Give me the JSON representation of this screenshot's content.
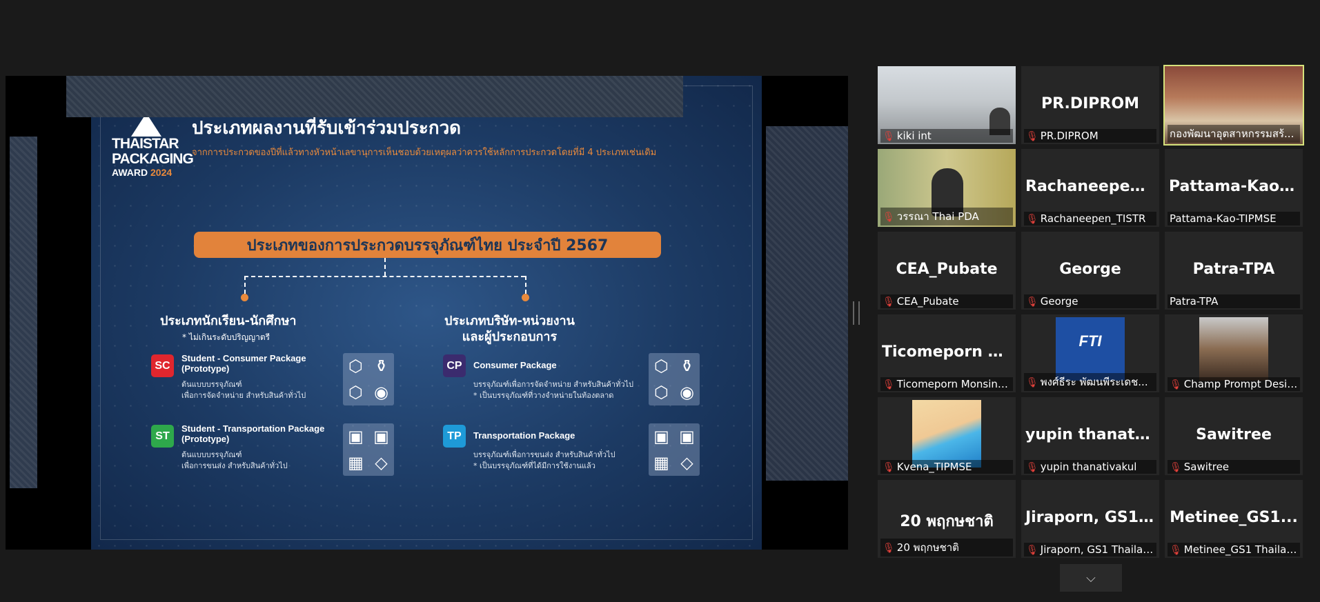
{
  "slide": {
    "logo_line1": "THAISTAR",
    "logo_line2": "PACKAGING",
    "logo_line3_a": "AWARD",
    "logo_line3_b": "2024",
    "title": "ประเภทผลงานที่รับเข้าร่วมประกวด",
    "subtitle": "จากการประกวดของปีที่แล้วทางหัวหน้าเลขานุการเห็นชอบด้วยเหตุผลว่าควรใช้หลักการประกวดโดยที่มี 4 ประเภทเช่นเดิม",
    "banner": "ประเภทของการประกวดบรรจุภัณฑ์ไทย ประจำปี 2567",
    "left_heading": "ประเภทนักเรียน-นักศึกษา",
    "left_note": "* ไม่เกินระดับปริญญาตรี",
    "right_heading_1": "ประเภทบริษัท-หน่วยงาน",
    "right_heading_2": "และผู้ประกอบการ",
    "categories": [
      {
        "code": "SC",
        "color": "#e0262e",
        "name": "Student - Consumer Package (Prototype)",
        "desc1": "ต้นแบบบรรจุภัณฑ์",
        "desc2": "เพื่อการจัดจำหน่าย สำหรับสินค้าทั่วไป",
        "icons": [
          "⬡",
          "⚱",
          "⬡",
          "◉"
        ]
      },
      {
        "code": "CP",
        "color": "#3b2b6e",
        "name": "Consumer Package",
        "desc1": "บรรจุภัณฑ์เพื่อการจัดจำหน่าย สำหรับสินค้าทั่วไป",
        "desc2": "* เป็นบรรจุภัณฑ์ที่วางจำหน่ายในท้องตลาด",
        "icons": [
          "⬡",
          "⚱",
          "⬡",
          "◉"
        ]
      },
      {
        "code": "ST",
        "color": "#2ea84b",
        "name": "Student - Transportation Package (Prototype)",
        "desc1": "ต้นแบบบรรจุภัณฑ์",
        "desc2": "เพื่อการขนส่ง สำหรับสินค้าทั่วไป",
        "icons": [
          "▣",
          "▣",
          "▦",
          "◇"
        ]
      },
      {
        "code": "TP",
        "color": "#1e9ad8",
        "name": "Transportation Package",
        "desc1": "บรรจุภัณฑ์เพื่อการขนส่ง สำหรับสินค้าทั่วไป",
        "desc2": "* เป็นบรรจุภัณฑ์ที่ได้มีการใช้งานแล้ว",
        "icons": [
          "▣",
          "▣",
          "▦",
          "◇"
        ]
      }
    ]
  },
  "participants": [
    {
      "name": "kiki int",
      "big": "",
      "media": "office",
      "muted": true
    },
    {
      "name": "PR.DIPROM",
      "big": "PR.DIPROM",
      "media": "",
      "muted": true
    },
    {
      "name": "กองพัฒนาอุตสาหกรรมสร้...",
      "big": "",
      "media": "meet",
      "muted": false,
      "active": true
    },
    {
      "name": "วรรณา Thai PDA",
      "big": "",
      "media": "pda",
      "muted": true
    },
    {
      "name": "Rachaneepen_TISTR",
      "big": "Rachaneepen_...",
      "media": "",
      "muted": true
    },
    {
      "name": "Pattama-Kao-TIPMSE",
      "big": "Pattama-Kao-...",
      "media": "",
      "muted": false
    },
    {
      "name": "CEA_Pubate",
      "big": "CEA_Pubate",
      "media": "",
      "muted": true
    },
    {
      "name": "George",
      "big": "George",
      "media": "",
      "muted": true
    },
    {
      "name": "Patra-TPA",
      "big": "Patra-TPA",
      "media": "",
      "muted": false
    },
    {
      "name": "Ticomeporn Monsint...",
      "big": "Ticomeporn M...",
      "media": "",
      "muted": true
    },
    {
      "name": "พงศ์ธีระ พัฒนพีระเดช...",
      "big": "",
      "media": "fti",
      "muted": true
    },
    {
      "name": "Champ Prompt Design",
      "big": "",
      "media": "face",
      "muted": true
    },
    {
      "name": "Kvena_TIPMSE",
      "big": "",
      "media": "beach",
      "muted": true
    },
    {
      "name": "yupin thanativakul",
      "big": "yupin thanativ...",
      "media": "",
      "muted": true
    },
    {
      "name": "Sawitree",
      "big": "Sawitree",
      "media": "",
      "muted": true
    },
    {
      "name": "20 พฤกษชาติ",
      "big": "20 พฤกษชาติ",
      "media": "",
      "muted": true
    },
    {
      "name": "Jiraporn, GS1 Thailand",
      "big": "Jiraporn, GS1...",
      "media": "",
      "muted": true
    },
    {
      "name": "Metinee_GS1 Thailand",
      "big": "Metinee_GS1...",
      "media": "",
      "muted": true
    }
  ],
  "fti_label": "FTI",
  "icons": {
    "mic_muted": "mic-muted-icon",
    "chevron": "chevron-down-icon"
  },
  "colors": {
    "active_speaker": "#d6e37c",
    "accent": "#e2833b"
  }
}
